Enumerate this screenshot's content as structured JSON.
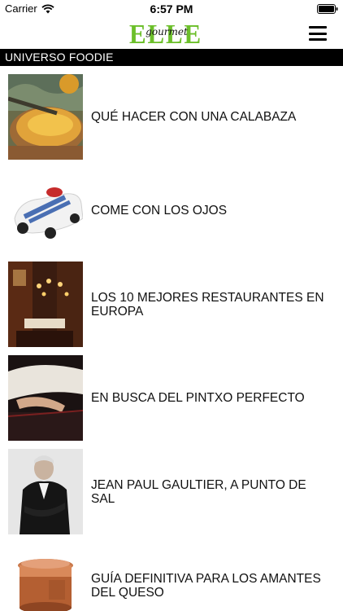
{
  "status_bar": {
    "carrier": "Carrier",
    "time": "6:57 PM",
    "wifi_icon": "wifi-icon",
    "battery_icon": "battery-icon"
  },
  "header": {
    "logo_main": "ELLE",
    "logo_script": "gourmet",
    "menu_icon": "hamburger-menu-icon",
    "brand_color": "#6cbf2a"
  },
  "section": {
    "title": "UNIVERSO FOODIE"
  },
  "articles": [
    {
      "title": "QUÉ HACER CON UNA CALABAZA",
      "image": "pumpkin-dish-image"
    },
    {
      "title": "COME CON LOS OJOS",
      "image": "white-car-dessert-image"
    },
    {
      "title": "LOS 10 MEJORES RESTAURANTES EN EUROPA",
      "image": "restaurant-interior-image"
    },
    {
      "title": "EN BUSCA DEL PINTXO PERFECTO",
      "image": "chef-hands-image"
    },
    {
      "title": "JEAN PAUL GAULTIER, A PUNTO DE SAL",
      "image": "jean-paul-gaultier-portrait-image"
    },
    {
      "title": "GUÍA DEFINITIVA PARA LOS AMANTES DEL QUESO",
      "image": "copper-tin-image"
    }
  ]
}
